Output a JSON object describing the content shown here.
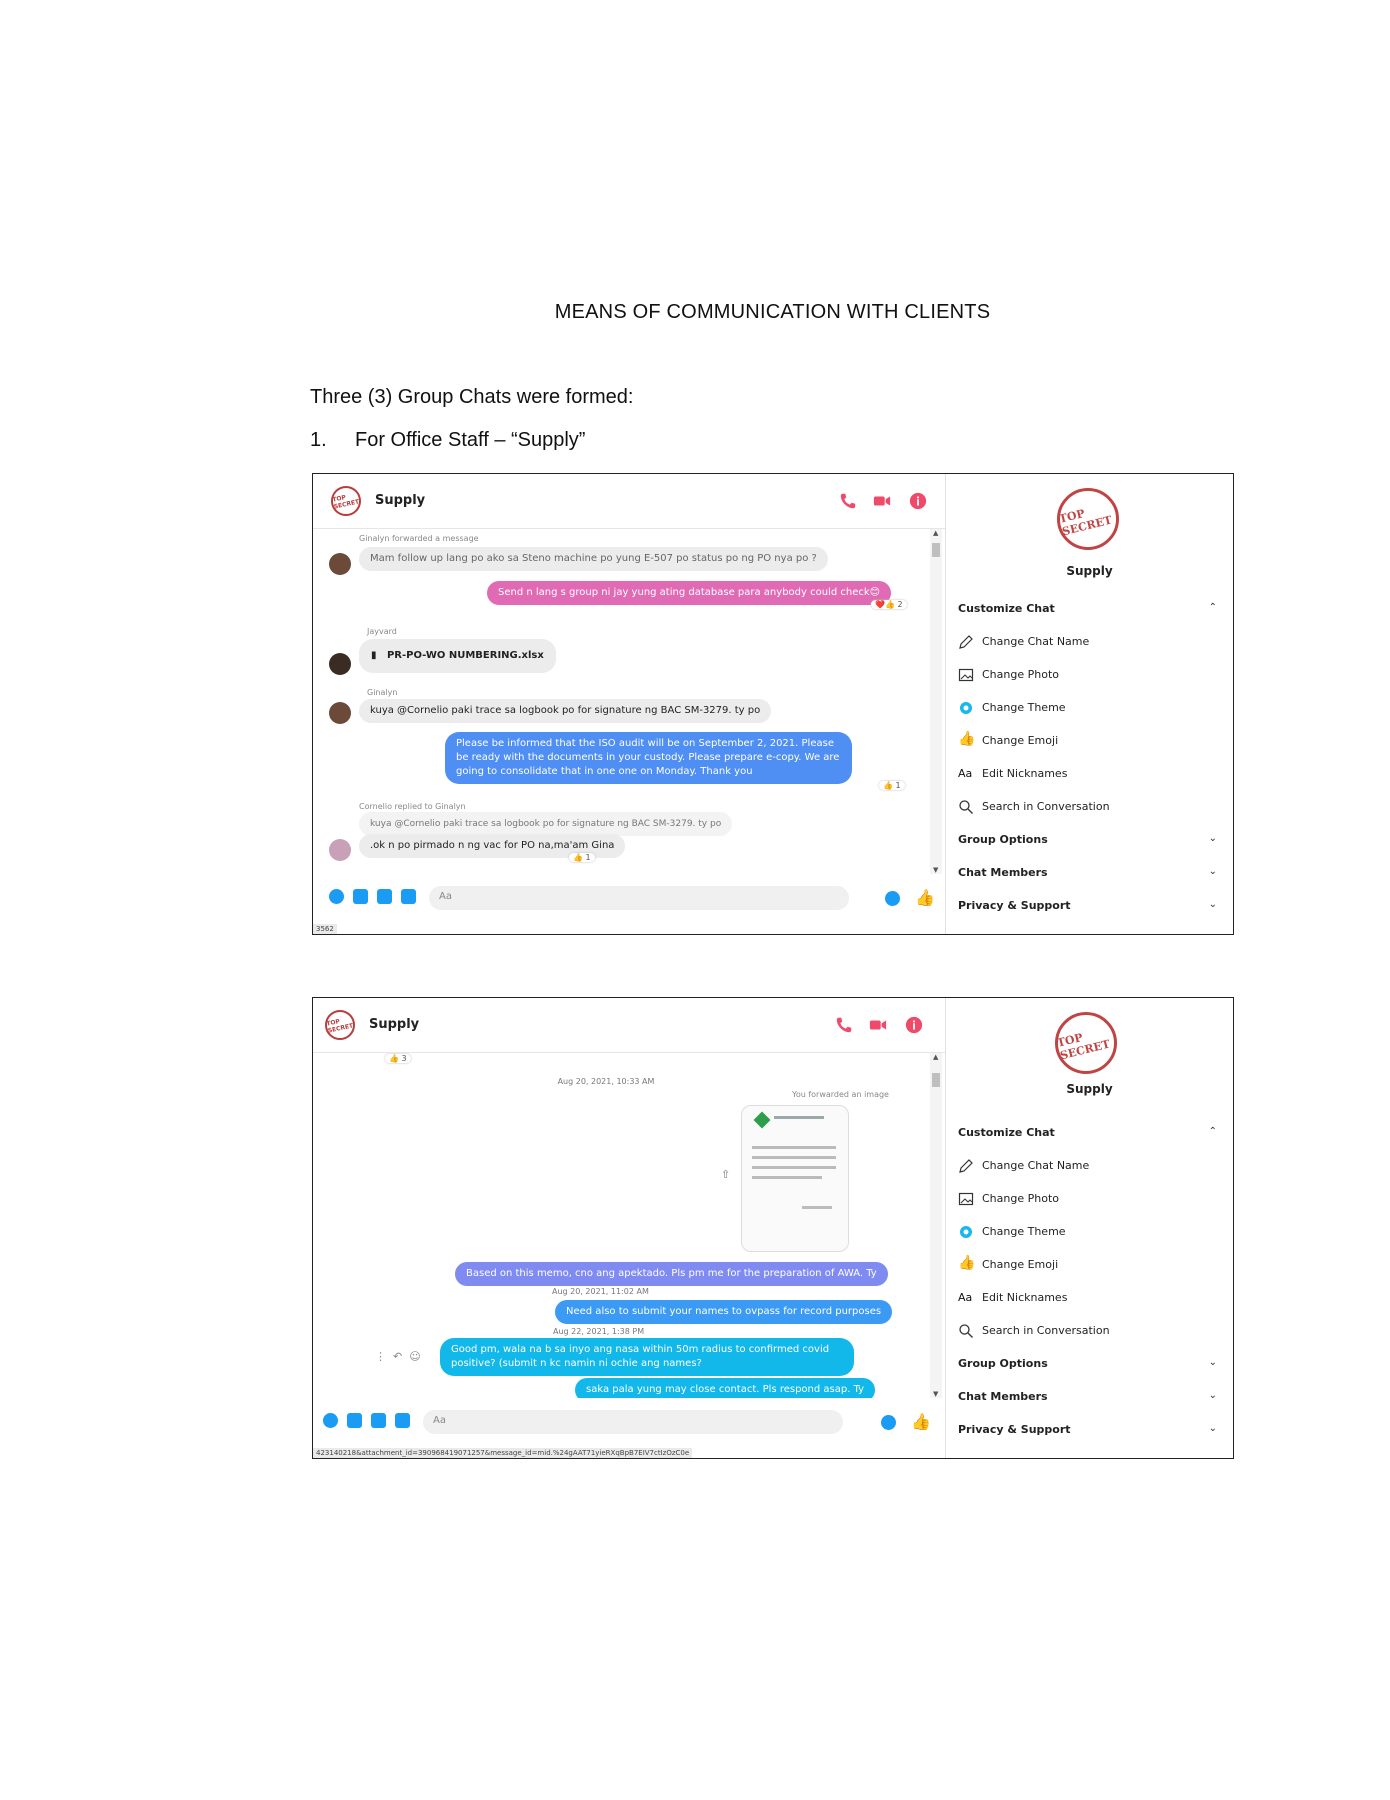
{
  "document": {
    "title": "MEANS OF COMMUNICATION WITH CLIENTS",
    "intro": "Three (3) Group Chats were formed:",
    "item_number": "1.",
    "item_text": "For Office Staff – “Supply”"
  },
  "chat": {
    "name": "Supply",
    "composer_placeholder": "Aa"
  },
  "sidebar": {
    "logo_text": "TOP SECRET",
    "name": "Supply",
    "customize": "Customize Chat",
    "items": [
      "Change Chat Name",
      "Change Photo",
      "Change Theme",
      "Change Emoji",
      "Edit Nicknames",
      "Search in Conversation"
    ],
    "group_options": "Group Options",
    "chat_members": "Chat Members",
    "privacy": "Privacy & Support",
    "aa_glyph": "Aa"
  },
  "shot1": {
    "forward_note": "Ginalyn forwarded a message",
    "m1": "Mam follow up lang po ako sa Steno machine po yung E-507 po status po ng PO nya po ?",
    "m2": "Send n lang s group ni jay yung ating database para anybody could check😊",
    "m2_reaction": "❤️👍 2",
    "sender_jayvard": "Jayvard",
    "file": "PR-PO-WO NUMBERING.xlsx",
    "sender_ginalyn": "Ginalyn",
    "m3": "kuya @Cornelio paki trace sa logbook po for signature ng BAC SM-3279. ty po",
    "m4": "Please be informed that the ISO audit will be on September 2, 2021.  Please be ready with the documents in your custody.  Please prepare e-copy.  We are going to consolidate that in one one on Monday.  Thank you",
    "m4_reaction": "👍 1",
    "reply_note": "Cornelio replied to Ginalyn",
    "quoted": "kuya @Cornelio paki trace sa logbook po for signature ng BAC SM-3279. ty po",
    "m5": ".ok n po pirmado n ng vac for PO na,ma'am Gina",
    "m5_reaction": "👍 1",
    "status": "3562"
  },
  "shot2": {
    "top_reaction": "👍 3",
    "stamp1": "Aug 20, 2021, 10:33 AM",
    "forward_note": "You forwarded an image",
    "m1": "Based on this memo, cno ang apektado. Pls pm me for the preparation of AWA. Ty",
    "stamp2": "Aug 20, 2021, 11:02 AM",
    "m2": "Need also to submit your names to ovpass for record purposes",
    "stamp3": "Aug 22, 2021, 1:38 PM",
    "m3": "Good pm, wala na b sa inyo ang nasa within 50m radius  to confirmed covid positive? (submit n kc namin ni ochie ang names?",
    "m4": "saka pala yung may close contact. Pls respond asap. Ty",
    "status": "423140218&attachment_id=390968419071257&message_id=mid.%24gAAT71yieRXqBpB7EIV7ctIzOzC0e"
  },
  "colors": {
    "messenger_blue": "#1a9cf5",
    "header_red": "#f04a6b"
  }
}
